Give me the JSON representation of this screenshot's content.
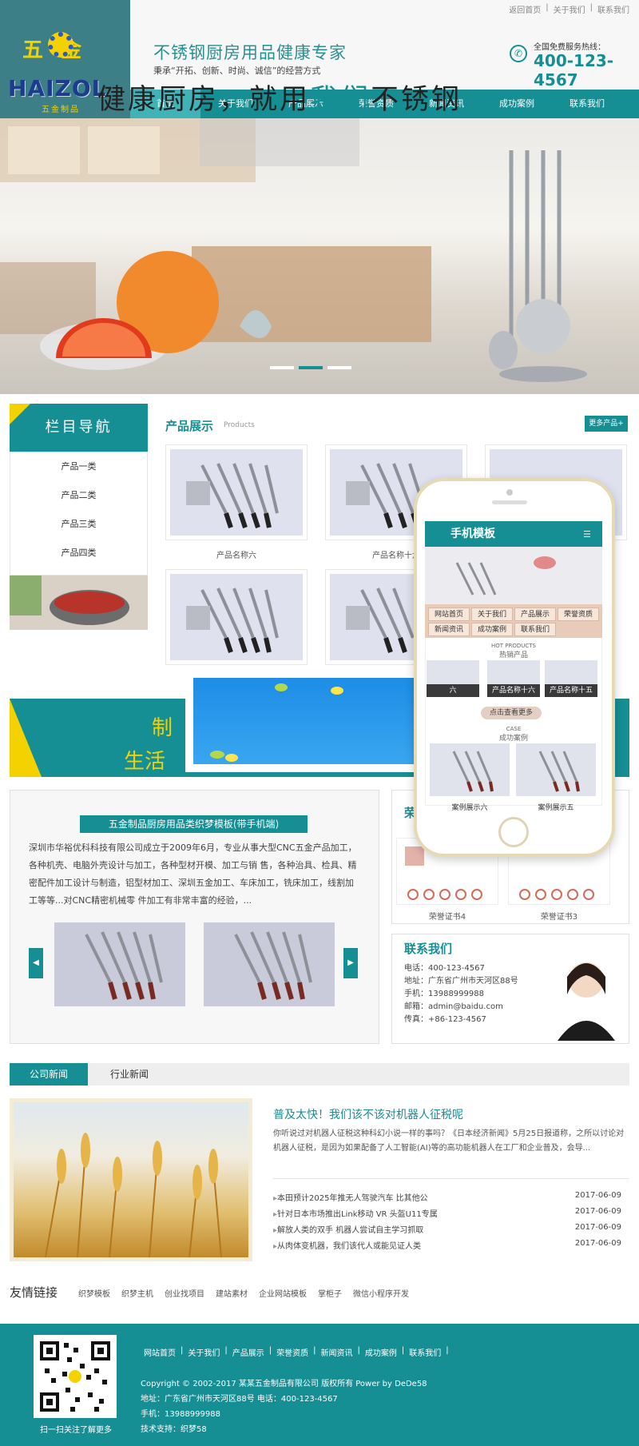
{
  "top_links": [
    "返回首页",
    "关于我们",
    "联系我们"
  ],
  "logo": {
    "cn": "五金",
    "en": "HAIZOL",
    "sub": "五金制品"
  },
  "header": {
    "slogan": "不锈钢厨房用品健康专家",
    "motto": "秉承“开拓、创新、时尚、诚信”的经营方式",
    "hotline_label": "全国免费服务热线：",
    "hotline": "400-123-4567"
  },
  "nav": [
    "首页",
    "关于我们",
    "产品展示",
    "荣誉资质",
    "新闻资讯",
    "成功案例",
    "联系我们"
  ],
  "banner": {
    "text_pre": "健康厨房，就用",
    "text_hl": "我们",
    "text_post": "不锈钢"
  },
  "left_col": {
    "title": "栏目导航",
    "items": [
      "产品一类",
      "产品二类",
      "产品三类",
      "产品四类"
    ]
  },
  "products": {
    "title": "产品展示",
    "subtitle": "Products",
    "more": "更多产品+",
    "items": [
      "产品名称六",
      "产品名称十六",
      "",
      "",
      "",
      ""
    ]
  },
  "strip": {
    "line1": "制",
    "line2": "生活"
  },
  "about": {
    "title": "五金制品厨房用品类织梦模板(带手机端)",
    "text": "深圳市华裕优科科技有限公司成立于2009年6月，专业从事大型CNC五金产品加工，各种机壳、电脑外壳设计与加工，各种型材开模、加工与销 售，各种治具、检具、精密配件加工设计与制造，铝型材加工、深圳五金加工、车床加工，铣床加工，线割加工等等...对CNC精密机械零 件加工有非常丰富的经验，..."
  },
  "honor": {
    "title": "荣",
    "certs": [
      "荣誉证书4",
      "荣誉证书3"
    ]
  },
  "contact": {
    "title": "联系我们",
    "lines": [
      "电话：400-123-4567",
      "地址：广东省广州市天河区88号",
      "手机：13988999988",
      "邮箱：admin@baidu.com",
      "传真：+86-123-4567"
    ]
  },
  "mobile": {
    "title": "手机模板",
    "nav": [
      "网站首页",
      "关于我们",
      "产品展示",
      "荣誉资质",
      "新闻资讯",
      "成功案例",
      "联系我们"
    ],
    "hot_en": "HOT PRODUCTS",
    "hot_cn": "热销产品",
    "prods": [
      "六",
      "产品名称十六",
      "产品名称十五"
    ],
    "more": "点击查看更多",
    "case_en": "CASE",
    "case_cn": "成功案例",
    "cases": [
      "案例展示六",
      "案例展示五"
    ]
  },
  "news": {
    "tabs": [
      "公司新闻",
      "行业新闻"
    ],
    "headline": "普及太快！我们该不该对机器人征税呢",
    "desc": "你听说过对机器人征税这种科幻小说一样的事吗？《日本经济新闻》5月25日报道称，之所以讨论对机器人征税，是因为如果配备了人工智能(AI)等的高功能机器人在工厂和企业普及，会导...",
    "items": [
      {
        "t": "本田预计2025年推无人驾驶汽车 比其他公",
        "d": "2017-06-09"
      },
      {
        "t": "针对日本市场推出Link移动 VR 头盔U11专属",
        "d": "2017-06-09"
      },
      {
        "t": "解放人类的双手 机器人尝试自主学习抓取",
        "d": "2017-06-09"
      },
      {
        "t": "从肉体变机器，我们该代人或能见证人类",
        "d": "2017-06-09"
      }
    ]
  },
  "links": {
    "title": "友情链接",
    "items": [
      "织梦模板",
      "织梦主机",
      "创业找项目",
      "建站素材",
      "企业网站模板",
      "掌柜子",
      "微信小程序开发"
    ]
  },
  "footer": {
    "nav": [
      "网站首页",
      "关于我们",
      "产品展示",
      "荣誉资质",
      "新闻资讯",
      "成功案例",
      "联系我们"
    ],
    "qr_caption": "扫一扫关注了解更多",
    "lines": [
      "Copyright © 2002-2017 某某五金制品有限公司 版权所有 Power by DeDe58",
      "地址：广东省广州市天河区88号 电话：400-123-4567",
      "手机：13988999988",
      "技术支持：织梦58"
    ]
  },
  "colors": {
    "accent": "#158e94",
    "logo_yellow": "#f3d200"
  }
}
